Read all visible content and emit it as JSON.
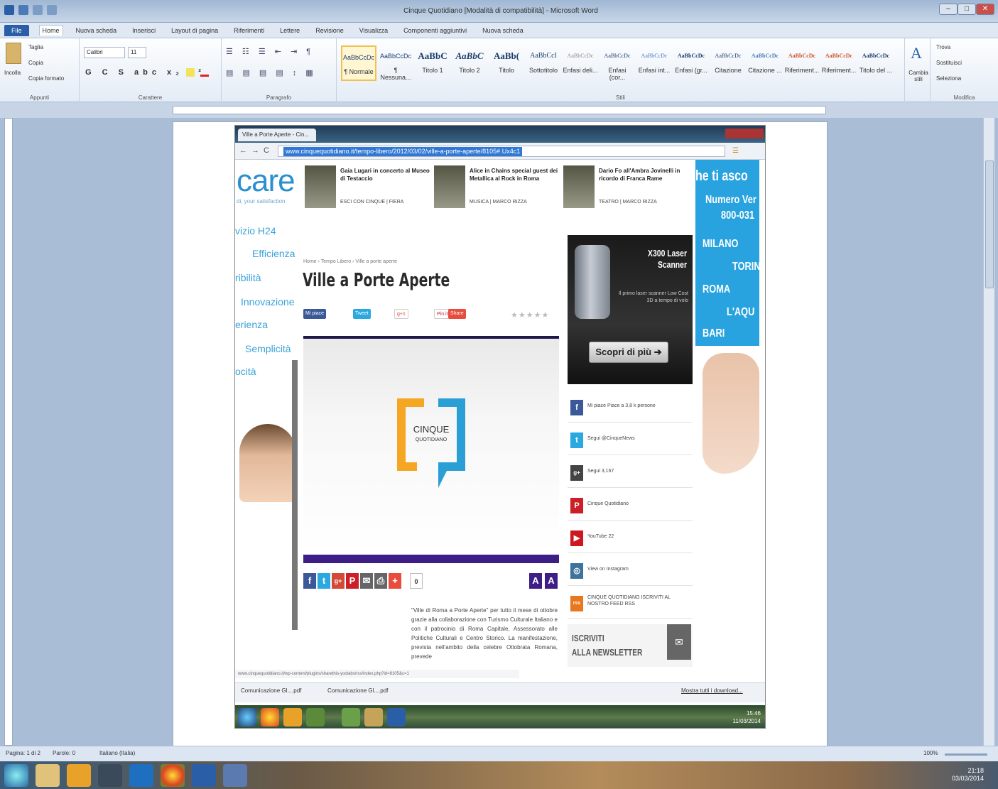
{
  "word": {
    "title": "Cinque Quotidiano [Modalità di compatibilità] - Microsoft Word",
    "tabs": [
      "File",
      "Home",
      "Nuova scheda",
      "Inserisci",
      "Layout di pagina",
      "Riferimenti",
      "Lettere",
      "Revisione",
      "Visualizza",
      "Componenti aggiuntivi",
      "Nuova scheda"
    ],
    "active_tab": "Home",
    "clipboard": {
      "paste": "Incolla",
      "cut": "Taglia",
      "copy": "Copia",
      "format": "Copia formato",
      "label": "Appunti"
    },
    "font": {
      "name": "Calibri",
      "size": "11",
      "label": "Carattere"
    },
    "paragraph_label": "Paragrafo",
    "styles": [
      {
        "sample": "AaBbCcDc",
        "name": "¶ Normale"
      },
      {
        "sample": "AaBbCcDc",
        "name": "¶ Nessuna..."
      },
      {
        "sample": "AaBbC",
        "name": "Titolo 1"
      },
      {
        "sample": "AaBbC",
        "name": "Titolo 2"
      },
      {
        "sample": "AaBb(",
        "name": "Titolo"
      },
      {
        "sample": "AaBbCcI",
        "name": "Sottotitolo"
      },
      {
        "sample": "AaBbCcDc",
        "name": "Enfasi deli..."
      },
      {
        "sample": "AaBbCcDc",
        "name": "Enfasi (cor..."
      },
      {
        "sample": "AaBbCcDc",
        "name": "Enfasi int..."
      },
      {
        "sample": "AaBbCcDc",
        "name": "Enfasi (gr..."
      },
      {
        "sample": "AaBbCcDc",
        "name": "Citazione"
      },
      {
        "sample": "AaBbCcDc",
        "name": "Citazione ..."
      },
      {
        "sample": "AaBbCcDc",
        "name": "Riferiment..."
      },
      {
        "sample": "AaBbCcDc",
        "name": "Riferiment..."
      },
      {
        "sample": "AaBbCcDc",
        "name": "Titolo del ..."
      }
    ],
    "styles_label": "Stili",
    "change_styles": "Cambia stili",
    "editing": {
      "find": "Trova",
      "replace": "Sostituisci",
      "select": "Seleziona",
      "label": "Modifica"
    },
    "status": {
      "page": "Pagina: 1 di 2",
      "words": "Parole: 0",
      "lang": "Italiano (Italia)",
      "zoom": "100%"
    }
  },
  "browser": {
    "tab_title": "Ville a Porte Aperte - Cin...",
    "url": "www.cinquequotidiano.it/tempo-libero/2012/03/02/ville-a-porte-aperte/8105#.Ux4c1",
    "status_url": "www.cinquequotidiano.it/wp-content/plugins/sharethis-yoolabs/rss/index.php?id=8105&c=1",
    "downloads": [
      "Comunicazione Gl....pdf",
      "Comunicazione Gl....pdf"
    ],
    "show_all": "Mostra tutti i download..."
  },
  "site": {
    "care": "care",
    "care_sub": "di, your satisfaction",
    "left_words": [
      "vizio H24",
      "Efficienza",
      "ribilità",
      "Innovazione",
      "erienza",
      "Semplicità",
      "ocità"
    ],
    "teasers": [
      {
        "title": "Gaia Lugari in concerto al Museo di Testaccio",
        "cat": "ESCI CON CINQUE | FIERA"
      },
      {
        "title": "Alice in Chains special guest dei Metallica al Rock in Roma",
        "cat": "MUSICA | MARCO RIZZA"
      },
      {
        "title": "Dario Fo all'Ambra Jovinelli in ricordo di Franca Rame",
        "cat": "TEATRO | MARCO RIZZA"
      }
    ],
    "breadcrumb": "Home › Tempo Libero › Ville a porte aperte",
    "headline": "Ville a Porte Aperte",
    "share": {
      "like": "Mi piace",
      "tweet": "Tweet",
      "gplus": "g+1",
      "pin": "Pin it",
      "share": "Share"
    },
    "stars": "★★★★★",
    "logo_top": "CINQUE",
    "logo_bottom": "QUOTIDIANO",
    "count": "0",
    "font_buttons": [
      "A",
      "A"
    ],
    "article": "\"Ville di Roma a Porte Aperte\" per tutto il mese di ottobre grazie alla collaborazione con Turismo Culturale Italiano e con il patrocinio di Roma Capitale, Assessorato alle Politiche Culturali e Centro Storico. La manifestazione, prevista nell'ambito della celebre Ottobrata Romana, prevede",
    "ad": {
      "title": "X300 Laser Scanner",
      "sub": "Il primo laser scanner Low Cost 3D a tempo di volo",
      "button": "Scopri di più ➔"
    },
    "social": [
      {
        "icon": "f",
        "label": "Mi piace  Piace a 3,8 k persone",
        "color": "#3b5998"
      },
      {
        "icon": "t",
        "label": "Segui @CinqueNews",
        "color": "#2aa9e0"
      },
      {
        "icon": "g+",
        "label": "Segui    3,167",
        "color": "#444"
      },
      {
        "icon": "P",
        "label": "Cinque Quotidiano",
        "color": "#cb2027"
      },
      {
        "icon": "▶",
        "label": "YouTube  22",
        "color": "#cc181e"
      },
      {
        "icon": "◎",
        "label": "View on Instagram",
        "color": "#3f729b"
      },
      {
        "icon": "rss",
        "label": "CINQUE QUOTIDIANO ISCRIVITI AL NOSTRO FEED RSS",
        "color": "#e8771e"
      }
    ],
    "newsletter": [
      "ISCRIVITI",
      "ALLA NEWSLETTER"
    ],
    "right_banner": [
      "he ti asco",
      "Numero Ver",
      "800-031",
      "MILANO",
      "TORIN",
      "ROMA",
      "L'AQU",
      "BARI"
    ]
  },
  "inner_clock": {
    "time": "15:46",
    "date": "11/03/2014"
  },
  "clock": {
    "time": "21:18",
    "date": "03/03/2014"
  },
  "colors": {
    "brand_blue": "#2b8fd0",
    "ribbon": "#dfe8f3",
    "doc_bg": "#a9bdd6"
  }
}
